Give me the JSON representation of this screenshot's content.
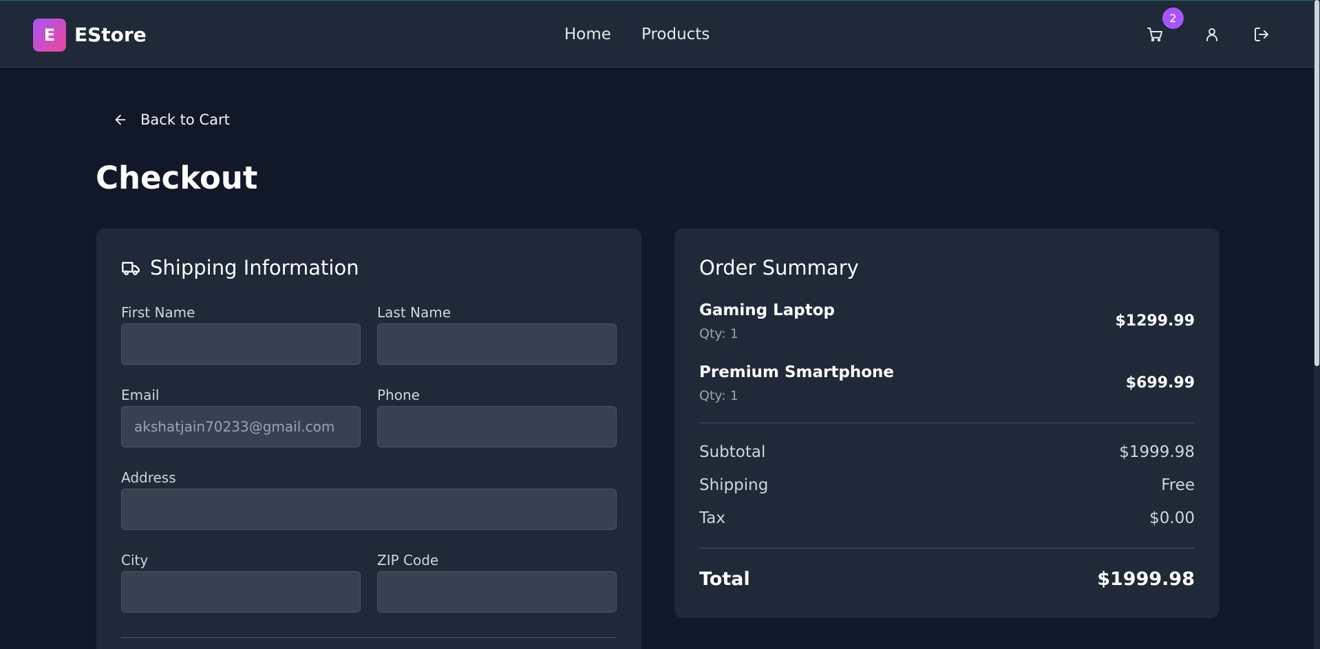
{
  "header": {
    "logo_letter": "E",
    "brand": "EStore",
    "nav": [
      "Home",
      "Products"
    ],
    "cart_count": "2",
    "icons": [
      "cart-icon",
      "user-icon",
      "logout-icon"
    ]
  },
  "back_link": "Back to Cart",
  "page_title": "Checkout",
  "shipping": {
    "title": "Shipping Information",
    "fields": {
      "first_name": {
        "label": "First Name",
        "value": ""
      },
      "last_name": {
        "label": "Last Name",
        "value": ""
      },
      "email": {
        "label": "Email",
        "value": "akshatjain70233@gmail.com"
      },
      "phone": {
        "label": "Phone",
        "value": ""
      },
      "address": {
        "label": "Address",
        "value": ""
      },
      "city": {
        "label": "City",
        "value": ""
      },
      "zip": {
        "label": "ZIP Code",
        "value": ""
      }
    }
  },
  "summary": {
    "title": "Order Summary",
    "items": [
      {
        "name": "Gaming Laptop",
        "qty": "Qty: 1",
        "price": "$1299.99"
      },
      {
        "name": "Premium Smartphone",
        "qty": "Qty: 1",
        "price": "$699.99"
      }
    ],
    "subtotal_label": "Subtotal",
    "subtotal": "$1999.98",
    "shipping_label": "Shipping",
    "shipping": "Free",
    "tax_label": "Tax",
    "tax": "$0.00",
    "total_label": "Total",
    "total": "$1999.98"
  },
  "colors": {
    "background": "#111827",
    "card": "#1f2937",
    "accent": "#a855f7",
    "logo_gradient_end": "#ec4899"
  }
}
